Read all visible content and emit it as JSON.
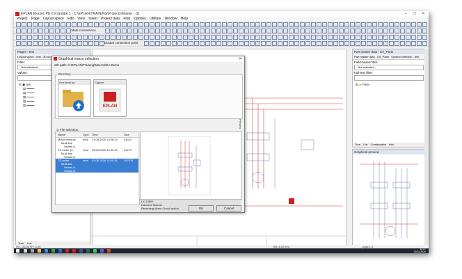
{
  "app": {
    "title": "EPLAN Electric P8 2.9 Update 1 - C:\\EPLAN\\TRAINING\\Projects\\Master - [1]",
    "window_controls": "–  ▢  ✕"
  },
  "menu": [
    "Project",
    "Page",
    "Layout space",
    "Edit",
    "View",
    "Insert",
    "Project data",
    "Find",
    "Options",
    "Utilities",
    "Window",
    "Help"
  ],
  "toolbar": {
    "update_connections": "Update connections",
    "busbar_connection_point": "Busbar connection point"
  },
  "left_panel": {
    "header": "Pages - test",
    "tabs": [
      "Layout space - test",
      "3D mounting layout -",
      "Pages - test"
    ],
    "filter_label": "Filter:",
    "filter_value": "- Not activated -",
    "values_label": "Values:",
    "tree_root": "test",
    "bottom_tabs": [
      "Tree",
      "List"
    ]
  },
  "dialog": {
    "title": "Graphical macro selection",
    "path_label": "Wb path: C:\\EPLAN\\Training\\Macros\\EA Demo",
    "directory_label": "Directory",
    "thumbs": [
      "One level up",
      "Copper"
    ],
    "file_selection_label": "File selection",
    "columns": [
      "Name",
      "Type",
      "Time",
      "Size"
    ],
    "rows": [
      {
        "name": "Motor terminal",
        "type": "ema",
        "time": "23.05.2020 13:08:29",
        "size": "44443"
      },
      {
        "name": "Multi-line",
        "type": "",
        "time": "",
        "size": ""
      },
      {
        "name": "Variant A",
        "type": "",
        "time": "",
        "size": ""
      },
      {
        "name": "TD motor (3-",
        "type": "ema",
        "time": "23.05.2020 10:03:12",
        "size": "81273"
      },
      {
        "name": "Multi-line",
        "type": "",
        "time": "",
        "size": ""
      },
      {
        "name": "Variant A",
        "type": "",
        "time": "",
        "size": ""
      },
      {
        "name": "TD motor",
        "type": "ema",
        "time": "02.06.2020 11:51:35",
        "size": "167078"
      },
      {
        "name": "Multi-line",
        "type": "",
        "time": "",
        "size": ""
      },
      {
        "name": "Variant A",
        "type": "",
        "time": "",
        "size": ""
      },
      {
        "name": "Variant B",
        "type": "",
        "time": "",
        "size": ""
      }
    ],
    "info_lines": [
      "LX-13800",
      "Handson Macros",
      "Reversing Motor Circuit option"
    ],
    "ok_label": "OK",
    "cancel_label": "Cancel",
    "preview_tab": "Preview"
  },
  "right_panel": {
    "header": "Part master data - EA_Parts",
    "tabs": [
      "Part master data - EA_Parts",
      "Symbol selection - test"
    ],
    "field_filter_label": "Field-based filter:",
    "field_filter_value": "- Not activated -",
    "fulltext_label": "Full-text filter:",
    "tree_item": "Parts",
    "bottom_tabs": [
      "Tree",
      "List",
      "Combination",
      "Info"
    ],
    "preview_header": "Graphical preview"
  },
  "status": {
    "left": "RX: -26.05   RY: 2.00",
    "mid": "ON: 4.00 mm",
    "right": "Logic 1:1"
  },
  "taskbar": {
    "time": "12:27",
    "date": "02/11/2020"
  },
  "colors": {
    "accent_red": "#cc1f1f",
    "selection_blue": "#3b7fd4",
    "taskbar": "#1f2430"
  }
}
